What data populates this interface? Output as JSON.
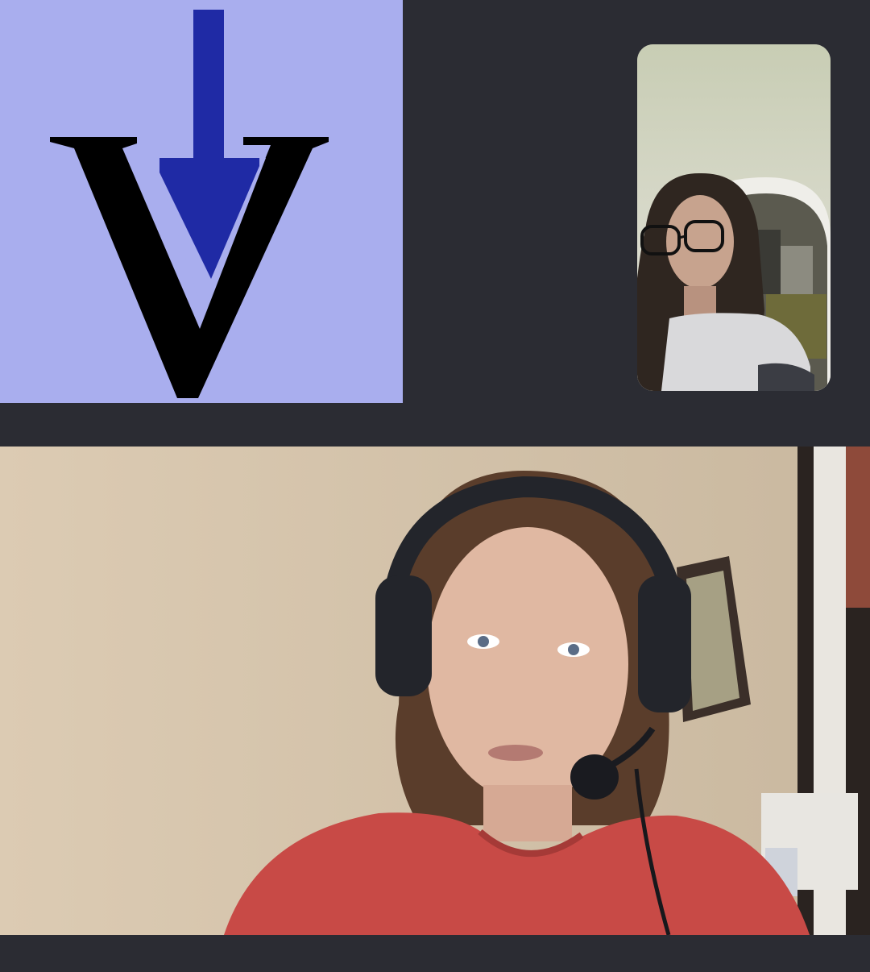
{
  "call": {
    "shared_tile": {
      "content": "logo-image",
      "colors": {
        "background": "#a9aeee",
        "letter": "#000000",
        "arrow": "#1f2aa5"
      }
    },
    "self_view": {
      "content": "camera-preview"
    },
    "main_participant": {
      "content": "participant-video"
    }
  },
  "theme": {
    "background": "#2b2c33"
  }
}
